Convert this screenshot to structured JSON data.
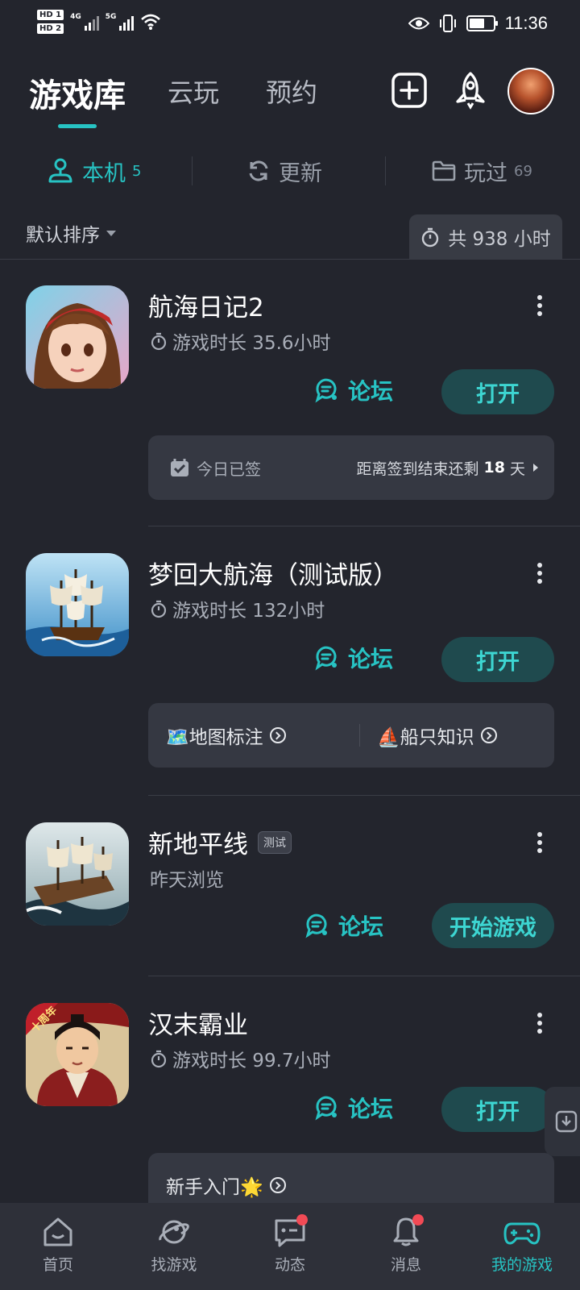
{
  "status_bar": {
    "time": "11:36",
    "hd1": "HD 1",
    "hd2": "HD 2",
    "net1": "4G",
    "net2": "5G"
  },
  "header": {
    "tabs": [
      {
        "label": "游戏库",
        "active": true
      },
      {
        "label": "云玩"
      },
      {
        "label": "预约"
      }
    ],
    "icons": [
      "add-icon",
      "rocket-icon",
      "avatar"
    ]
  },
  "subtabs": [
    {
      "label": "本机",
      "count": "5",
      "icon": "local-device-icon",
      "active": true
    },
    {
      "label": "更新",
      "count": "",
      "icon": "refresh-icon"
    },
    {
      "label": "玩过",
      "count": "69",
      "icon": "folder-icon"
    }
  ],
  "sort": {
    "label": "默认排序",
    "total": "共 938 小时"
  },
  "games": [
    {
      "name": "航海日记2",
      "meta": "游戏时长 35.6小时",
      "forum": "论坛",
      "action": "打开",
      "panel": {
        "left": "今日已签",
        "right_prefix": "距离签到结束还剩",
        "right_num": "18",
        "right_suffix": "天"
      }
    },
    {
      "name": "梦回大航海（测试版）",
      "meta": "游戏时长 132小时",
      "forum": "论坛",
      "action": "打开",
      "panel": {
        "link1": "🗺️地图标注",
        "link2": "⛵船只知识"
      }
    },
    {
      "name": "新地平线",
      "badge": "测试",
      "meta": "昨天浏览",
      "forum": "论坛",
      "action": "开始游戏"
    },
    {
      "name": "汉末霸业",
      "meta": "游戏时长 99.7小时",
      "forum": "论坛",
      "action": "打开",
      "icon_text": "十周年",
      "panel": {
        "link1": "新手入门🌟"
      }
    }
  ],
  "bottom_nav": [
    {
      "label": "首页",
      "icon": "home-icon"
    },
    {
      "label": "找游戏",
      "icon": "planet-icon"
    },
    {
      "label": "动态",
      "icon": "message-icon",
      "dot": true
    },
    {
      "label": "消息",
      "icon": "bell-icon",
      "dot": true
    },
    {
      "label": "我的游戏",
      "icon": "gamepad-icon",
      "active": true
    }
  ],
  "colors": {
    "accent": "#27c3c3",
    "background": "#23252d",
    "badge_dot": "#f24a55"
  }
}
